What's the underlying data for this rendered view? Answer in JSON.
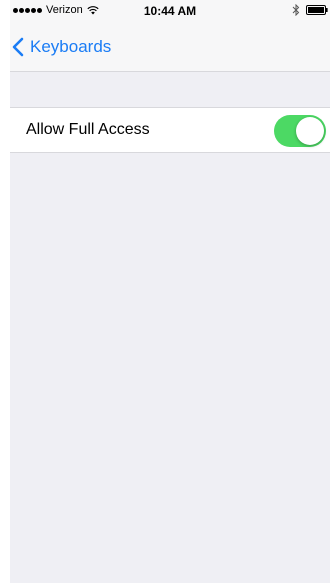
{
  "status_bar": {
    "carrier": "Verizon",
    "time": "10:44 AM",
    "signal_bars": 5,
    "icons": [
      "wifi-icon",
      "bluetooth-icon",
      "battery-icon"
    ]
  },
  "nav": {
    "back_label": "Keyboards",
    "back_icon": "chevron-left-icon"
  },
  "settings": {
    "rows": [
      {
        "label": "Allow Full Access",
        "toggle_on": true
      }
    ]
  },
  "colors": {
    "accent": "#1a7cf5",
    "toggle_on": "#4cd964",
    "background": "#efeff4"
  }
}
